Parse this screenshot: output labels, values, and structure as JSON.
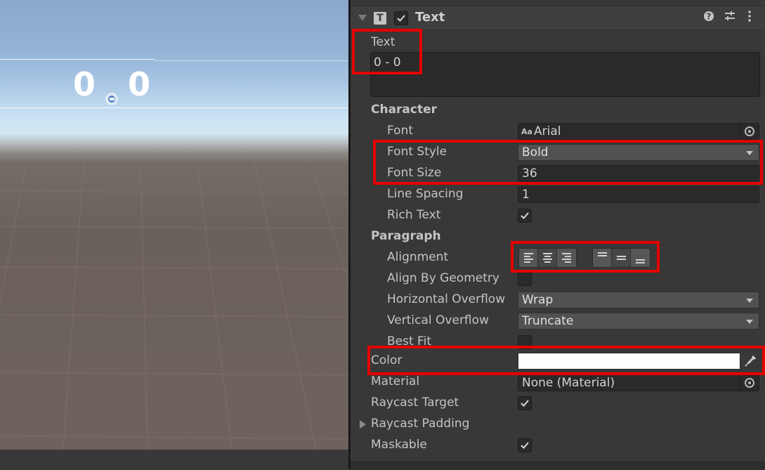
{
  "scene": {
    "score_left": "0",
    "score_right": "0"
  },
  "component": {
    "title": "Text",
    "icon": "T"
  },
  "text_field": {
    "label": "Text",
    "value": "0 - 0"
  },
  "character": {
    "heading": "Character",
    "font_label": "Font",
    "font_icon": "Aa",
    "font_value": "Arial",
    "font_style_label": "Font Style",
    "font_style_value": "Bold",
    "font_size_label": "Font Size",
    "font_size_value": "36",
    "line_spacing_label": "Line Spacing",
    "line_spacing_value": "1",
    "rich_text_label": "Rich Text",
    "rich_text_checked": true
  },
  "paragraph": {
    "heading": "Paragraph",
    "alignment_label": "Alignment",
    "horizontal_alignment": [
      "left",
      "center",
      "right"
    ],
    "horizontal_selected": "center",
    "vertical_alignment": [
      "upper",
      "middle",
      "lower"
    ],
    "vertical_selected": "middle",
    "align_by_geometry_label": "Align By Geometry",
    "align_by_geometry_checked": false,
    "horizontal_overflow_label": "Horizontal Overflow",
    "horizontal_overflow_value": "Wrap",
    "vertical_overflow_label": "Vertical Overflow",
    "vertical_overflow_value": "Truncate",
    "best_fit_label": "Best Fit",
    "best_fit_checked": false
  },
  "color": {
    "label": "Color",
    "value_hex": "#ffffff"
  },
  "material": {
    "label": "Material",
    "value": "None (Material)"
  },
  "raycast_target": {
    "label": "Raycast Target",
    "checked": true
  },
  "raycast_padding": {
    "label": "Raycast Padding"
  },
  "maskable": {
    "label": "Maskable",
    "checked": true
  },
  "highlight_color": "#e50000",
  "icons": [
    "fold-arrow-icon",
    "text-component-icon",
    "enable-checkbox-icon",
    "help-icon",
    "preset-sliders-icon",
    "kebab-menu-icon",
    "object-picker-icon",
    "eyedropper-icon",
    "lock-icon"
  ]
}
